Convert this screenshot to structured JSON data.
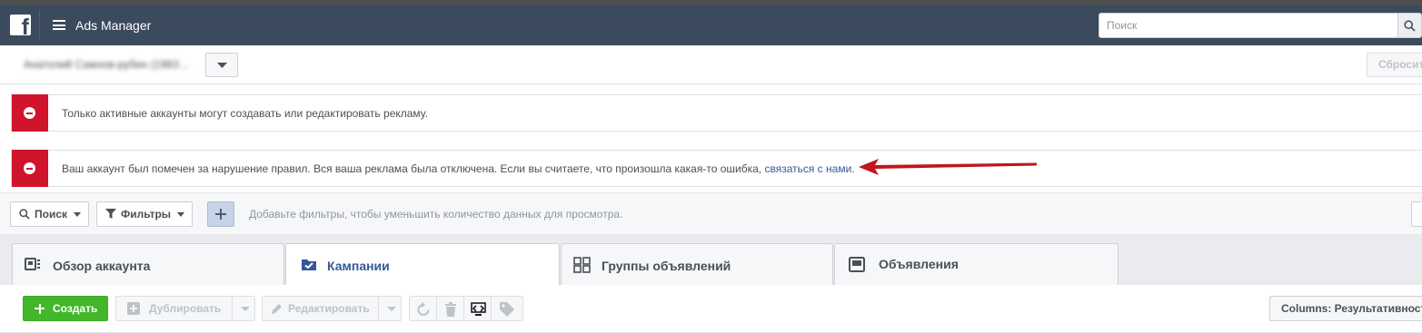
{
  "header": {
    "app_title": "Ads Manager",
    "search_placeholder": "Поиск",
    "brand_color": "#3b4a5c"
  },
  "account_bar": {
    "account_name": "Анатолий Сажнов-рубин (1983…",
    "reset_label": "Сбросить"
  },
  "alerts": [
    {
      "text": "Только активные аккаунты могут создавать или редактировать рекламу."
    },
    {
      "text": "Ваш аккаунт был помечен за нарушение правил. Вся ваша реклама была отключена. Если вы считаете, что произошла какая-то ошибка, ",
      "link": "связаться с нами."
    }
  ],
  "filter_bar": {
    "search_label": "Поиск",
    "filters_label": "Фильтры",
    "hint": "Добавьте фильтры, чтобы уменьшить количество данных для просмотра."
  },
  "tabs": [
    {
      "label": "Обзор аккаунта",
      "icon": "account-overview-icon"
    },
    {
      "label": "Кампании",
      "icon": "folder-check-icon",
      "active": true
    },
    {
      "label": "Группы объявлений",
      "icon": "grid-icon"
    },
    {
      "label": "Объявления",
      "icon": "ad-icon"
    }
  ],
  "toolbar": {
    "create_label": "Создать",
    "duplicate_label": "Дублировать",
    "edit_label": "Редактировать",
    "columns_label": "Columns: Результативность"
  },
  "colors": {
    "alert_red": "#d0142b",
    "create_green": "#42b72a",
    "link_blue": "#365899",
    "arrow_red": "#c0161c"
  }
}
